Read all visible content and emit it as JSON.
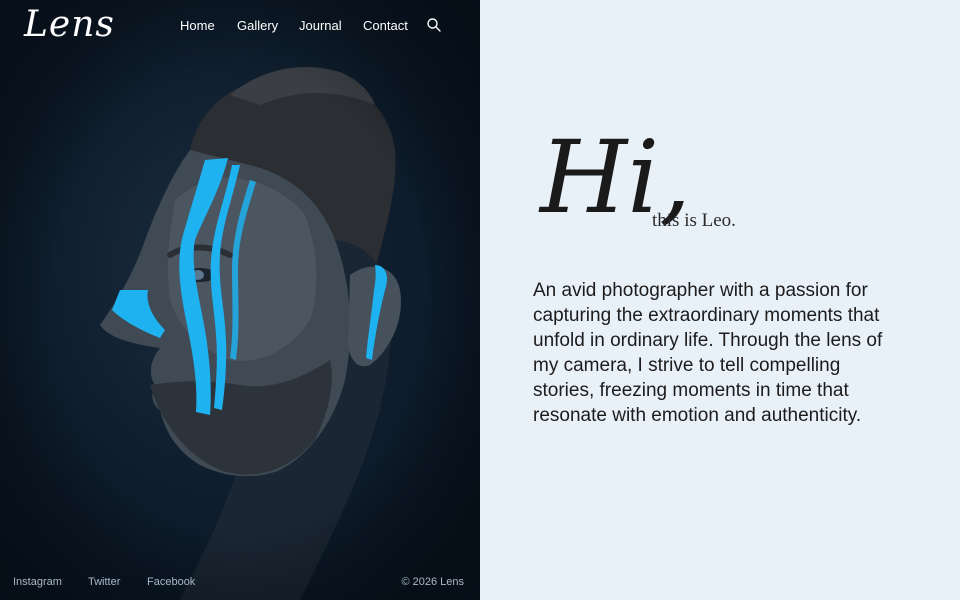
{
  "brand": {
    "logo": "Lens"
  },
  "nav": {
    "items": [
      {
        "label": "Home"
      },
      {
        "label": "Gallery"
      },
      {
        "label": "Journal"
      },
      {
        "label": "Contact"
      }
    ],
    "search_icon": "search-icon"
  },
  "hero": {
    "greeting": "Hi,",
    "subtitle": "this is Leo.",
    "bio": "An avid photographer with a passion for capturing the extraordinary moments that unfold in ordinary life. Through the lens of my camera, I strive to tell compelling stories, freezing moments in time that resonate with emotion and authenticity."
  },
  "footer": {
    "links": [
      {
        "label": "Instagram"
      },
      {
        "label": "Twitter"
      },
      {
        "label": "Facebook"
      }
    ],
    "copyright": "© 2026 Lens"
  },
  "colors": {
    "left_bg": "#0f1e2e",
    "right_bg": "#e8f0f8",
    "accent_paint": "#1fb2f0",
    "text_dark": "#1a1a1a"
  }
}
